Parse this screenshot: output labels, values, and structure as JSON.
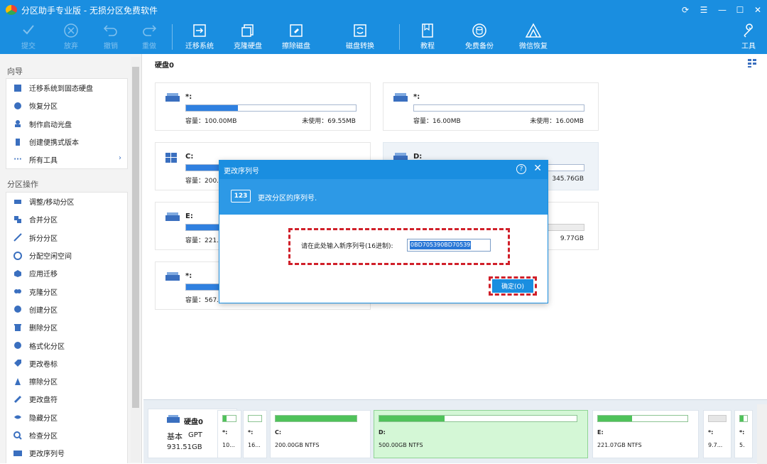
{
  "window": {
    "title": "分区助手专业版 - 无损分区免费软件",
    "controls": [
      "refresh-icon",
      "menu-icon",
      "minimize-icon",
      "maximize-icon",
      "close-icon"
    ]
  },
  "toolbar": {
    "commit": "提交",
    "discard": "放弃",
    "undo": "撤销",
    "redo": "重做",
    "migrate": "迁移系统",
    "clone": "克隆硬盘",
    "wipe": "擦除磁盘",
    "convert": "磁盘转换",
    "tutorial": "教程",
    "backup": "免费备份",
    "wechat": "微信恢复",
    "tools": "工具"
  },
  "sidebar": {
    "wizard_title": "向导",
    "wizard_items": [
      {
        "label": "迁移系统到固态硬盘",
        "icon": "migrate-ssd-icon"
      },
      {
        "label": "恢复分区",
        "icon": "recover-partition-icon"
      },
      {
        "label": "制作启动光盘",
        "icon": "bootable-disc-icon"
      },
      {
        "label": "创建便携式版本",
        "icon": "portable-version-icon"
      },
      {
        "label": "所有工具",
        "icon": "all-tools-icon"
      }
    ],
    "ops_title": "分区操作",
    "ops_items": [
      {
        "label": "调整/移动分区",
        "icon": "resize-move-icon"
      },
      {
        "label": "合并分区",
        "icon": "merge-partition-icon"
      },
      {
        "label": "拆分分区",
        "icon": "split-partition-icon"
      },
      {
        "label": "分配空闲空间",
        "icon": "allocate-space-icon"
      },
      {
        "label": "应用迁移",
        "icon": "app-migrate-icon"
      },
      {
        "label": "克隆分区",
        "icon": "clone-partition-icon"
      },
      {
        "label": "创建分区",
        "icon": "create-partition-icon"
      },
      {
        "label": "删除分区",
        "icon": "delete-partition-icon"
      },
      {
        "label": "格式化分区",
        "icon": "format-partition-icon"
      },
      {
        "label": "更改卷标",
        "icon": "change-label-icon"
      },
      {
        "label": "擦除分区",
        "icon": "wipe-partition-icon"
      },
      {
        "label": "更改盘符",
        "icon": "change-letter-icon"
      },
      {
        "label": "隐藏分区",
        "icon": "hide-partition-icon"
      },
      {
        "label": "检查分区",
        "icon": "check-partition-icon"
      },
      {
        "label": "更改序列号",
        "icon": "change-serial-icon"
      }
    ]
  },
  "main": {
    "disk_title": "硬盘0",
    "cards": [
      {
        "name": "*:",
        "fill": 0.305,
        "capacity": "容量：100.00MB",
        "free": "未使用：69.55MB",
        "icon": "drive-icon"
      },
      {
        "name": "*:",
        "fill": 0.0,
        "capacity": "容量：16.00MB",
        "free": "未使用：16.00MB",
        "icon": "drive-icon"
      },
      {
        "name": "C:",
        "fill": 0.2,
        "capacity": "容量：200.",
        "free": "",
        "icon": "windows-icon"
      },
      {
        "name": "D:",
        "fill": 0.3,
        "capacity": "",
        "free": "345.76GB",
        "icon": "drive-icon"
      },
      {
        "name": "E:",
        "fill": 0.2,
        "capacity": "容量：221.",
        "free": "",
        "icon": "drive-icon"
      },
      {
        "name": "",
        "fill": 0.0,
        "capacity": "",
        "free": "9.77GB",
        "icon": ""
      },
      {
        "name": "*:",
        "fill": 0.2,
        "capacity": "容量：567.",
        "free": "",
        "icon": "drive-icon"
      }
    ]
  },
  "bottom": {
    "disk_name": "硬盘0",
    "disk_type_a": "基本",
    "disk_type_b": "GPT",
    "disk_size": "931.51GB",
    "partitions": [
      {
        "name": "*:",
        "info": "10...",
        "fill": 0.3
      },
      {
        "name": "*:",
        "info": "16...",
        "fill": 0.0
      },
      {
        "name": "C:",
        "info": "200.00GB NTFS",
        "fill": 1.0
      },
      {
        "name": "D:",
        "info": "500.00GB NTFS",
        "fill": 0.33
      },
      {
        "name": "E:",
        "info": "221.07GB NTFS",
        "fill": 0.38
      },
      {
        "name": "*:",
        "info": "9.7...",
        "fill": 0.0
      },
      {
        "name": "*:",
        "info": "5.",
        "fill": 0.5
      }
    ]
  },
  "dialog": {
    "title": "更改序列号",
    "badge": "123",
    "heading": "更改分区的序列号.",
    "label": "请在此处输入新序列号(16进制):",
    "serial_value": "0BD705390BD70539",
    "ok_label": "确定(O)"
  },
  "colors": {
    "accent": "#1a8ee0",
    "highlight": "#d0202a",
    "used_fill": "#2f80e0",
    "partition_fill": "#4fc25a"
  }
}
